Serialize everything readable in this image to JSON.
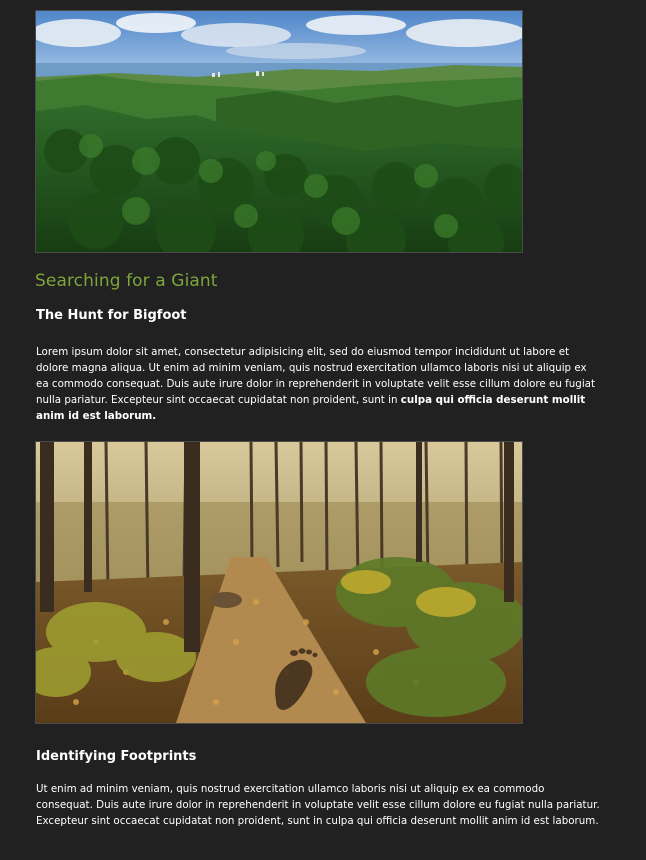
{
  "article": {
    "title": "Searching for a Giant",
    "section1": {
      "heading": "The Hunt for Bigfoot",
      "body_plain": "Lorem ipsum dolor sit amet, consectetur adipisicing elit, sed do eiusmod tempor incididunt ut labore et dolore magna aliqua. Ut enim ad minim veniam, quis nostrud exercitation ullamco laboris nisi ut aliquip ex ea commodo consequat. Duis aute irure dolor in reprehenderit in voluptate velit esse cillum dolore eu fugiat nulla pariatur. Excepteur sint occaecat cupidatat non proident, sunt in ",
      "body_bold": "culpa qui officia deserunt mollit anim id est laborum."
    },
    "section2": {
      "heading": "Identifying Footprints",
      "body": "Ut enim ad minim veniam, quis nostrud exercitation ullamco laboris nisi ut aliquip ex ea commodo consequat. Duis aute irure dolor in reprehenderit in voluptate velit esse cillum dolore eu fugiat nulla pariatur. Excepteur sint occaecat cupidatat non proident, sunt in culpa qui officia deserunt mollit anim id est laborum."
    }
  },
  "colors": {
    "background": "#212121",
    "title": "#7da63b",
    "text": "#ffffff"
  },
  "images": {
    "landscape": "forested-mountains-photo",
    "forest": "forest-trail-footprint-photo"
  }
}
